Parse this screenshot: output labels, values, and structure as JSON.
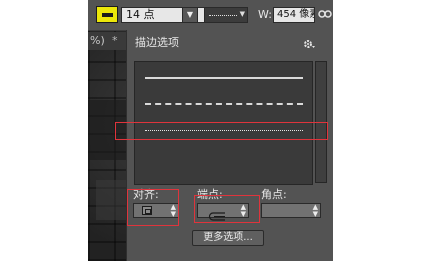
{
  "options_bar": {
    "stroke_size": "14 点",
    "width_label": "W:",
    "width_value": "454 像素"
  },
  "document_tab": {
    "label": "%)",
    "close": "*"
  },
  "panel": {
    "title": "描边选项",
    "gear_icon": "gear-icon",
    "presets": [
      {
        "name": "solid"
      },
      {
        "name": "dashed"
      },
      {
        "name": "dotted"
      }
    ],
    "align_label": "对齐:",
    "cap_label": "端点:",
    "corner_label": "角点:",
    "more_button": "更多选项..."
  },
  "colors": {
    "stroke_swatch": "#ece70a",
    "highlight": "#e0343c",
    "panel_bg": "#535353"
  }
}
